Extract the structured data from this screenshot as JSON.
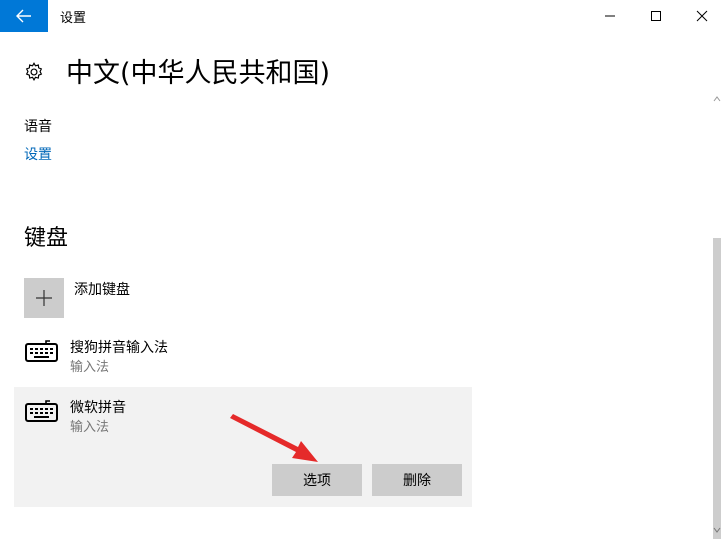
{
  "window": {
    "title": "设置"
  },
  "page": {
    "title": "中文(中华人民共和国)"
  },
  "speech": {
    "label": "语音",
    "settings_link": "设置"
  },
  "keyboards": {
    "heading": "键盘",
    "add_label": "添加键盘",
    "items": [
      {
        "name": "搜狗拼音输入法",
        "type": "输入法"
      },
      {
        "name": "微软拼音",
        "type": "输入法"
      }
    ],
    "options_button": "选项",
    "remove_button": "删除"
  },
  "colors": {
    "accent": "#0078d7",
    "link": "#0067b8",
    "arrow": "#e52a2a",
    "selected_bg": "#f2f2f2",
    "button_bg": "#cccccc"
  },
  "icons": {
    "back": "back-arrow-icon",
    "settings": "gear-icon",
    "add": "plus-icon",
    "keyboard": "keyboard-icon"
  }
}
